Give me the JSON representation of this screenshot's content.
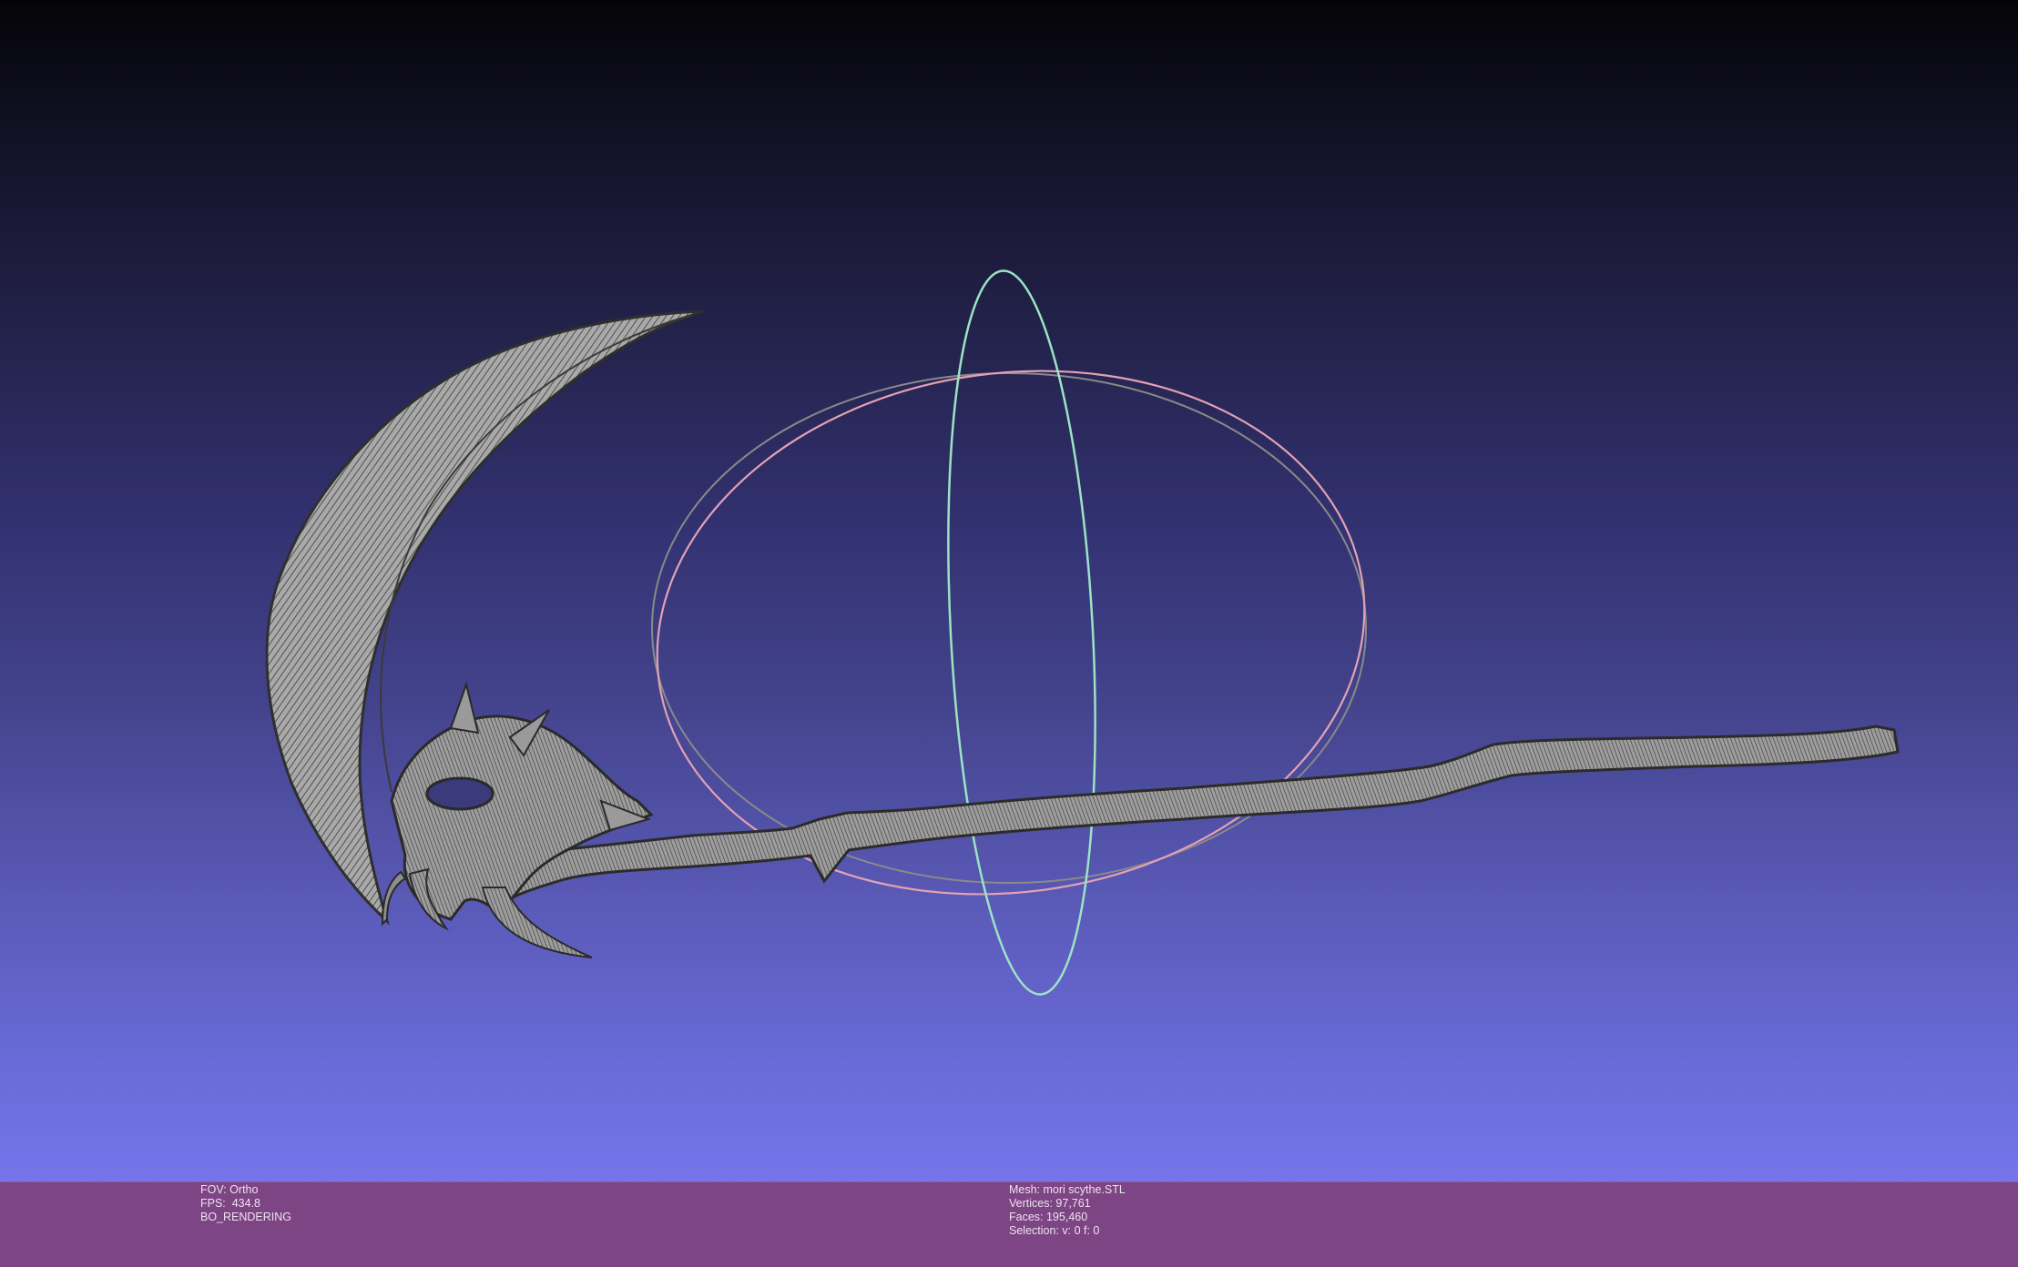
{
  "viewer": {
    "background_colors": [
      "#040408",
      "#7574ea"
    ],
    "status_bar_color": "#7e4584",
    "mesh_color": "#8a8a8a",
    "trackball_colors": {
      "horizontal": "#e3a1b4",
      "vertical": "#9be3c4",
      "depth": "#8c8c8c"
    }
  },
  "status": {
    "left": {
      "fov": "FOV: Ortho",
      "fps": "FPS:  434.8",
      "render_mode": "BO_RENDERING"
    },
    "middle": {
      "mesh": "Mesh: mori scythe.STL",
      "vertices": "Vertices: 97,761",
      "faces": "Faces: 195,460",
      "selection": "Selection: v: 0 f: 0"
    }
  }
}
